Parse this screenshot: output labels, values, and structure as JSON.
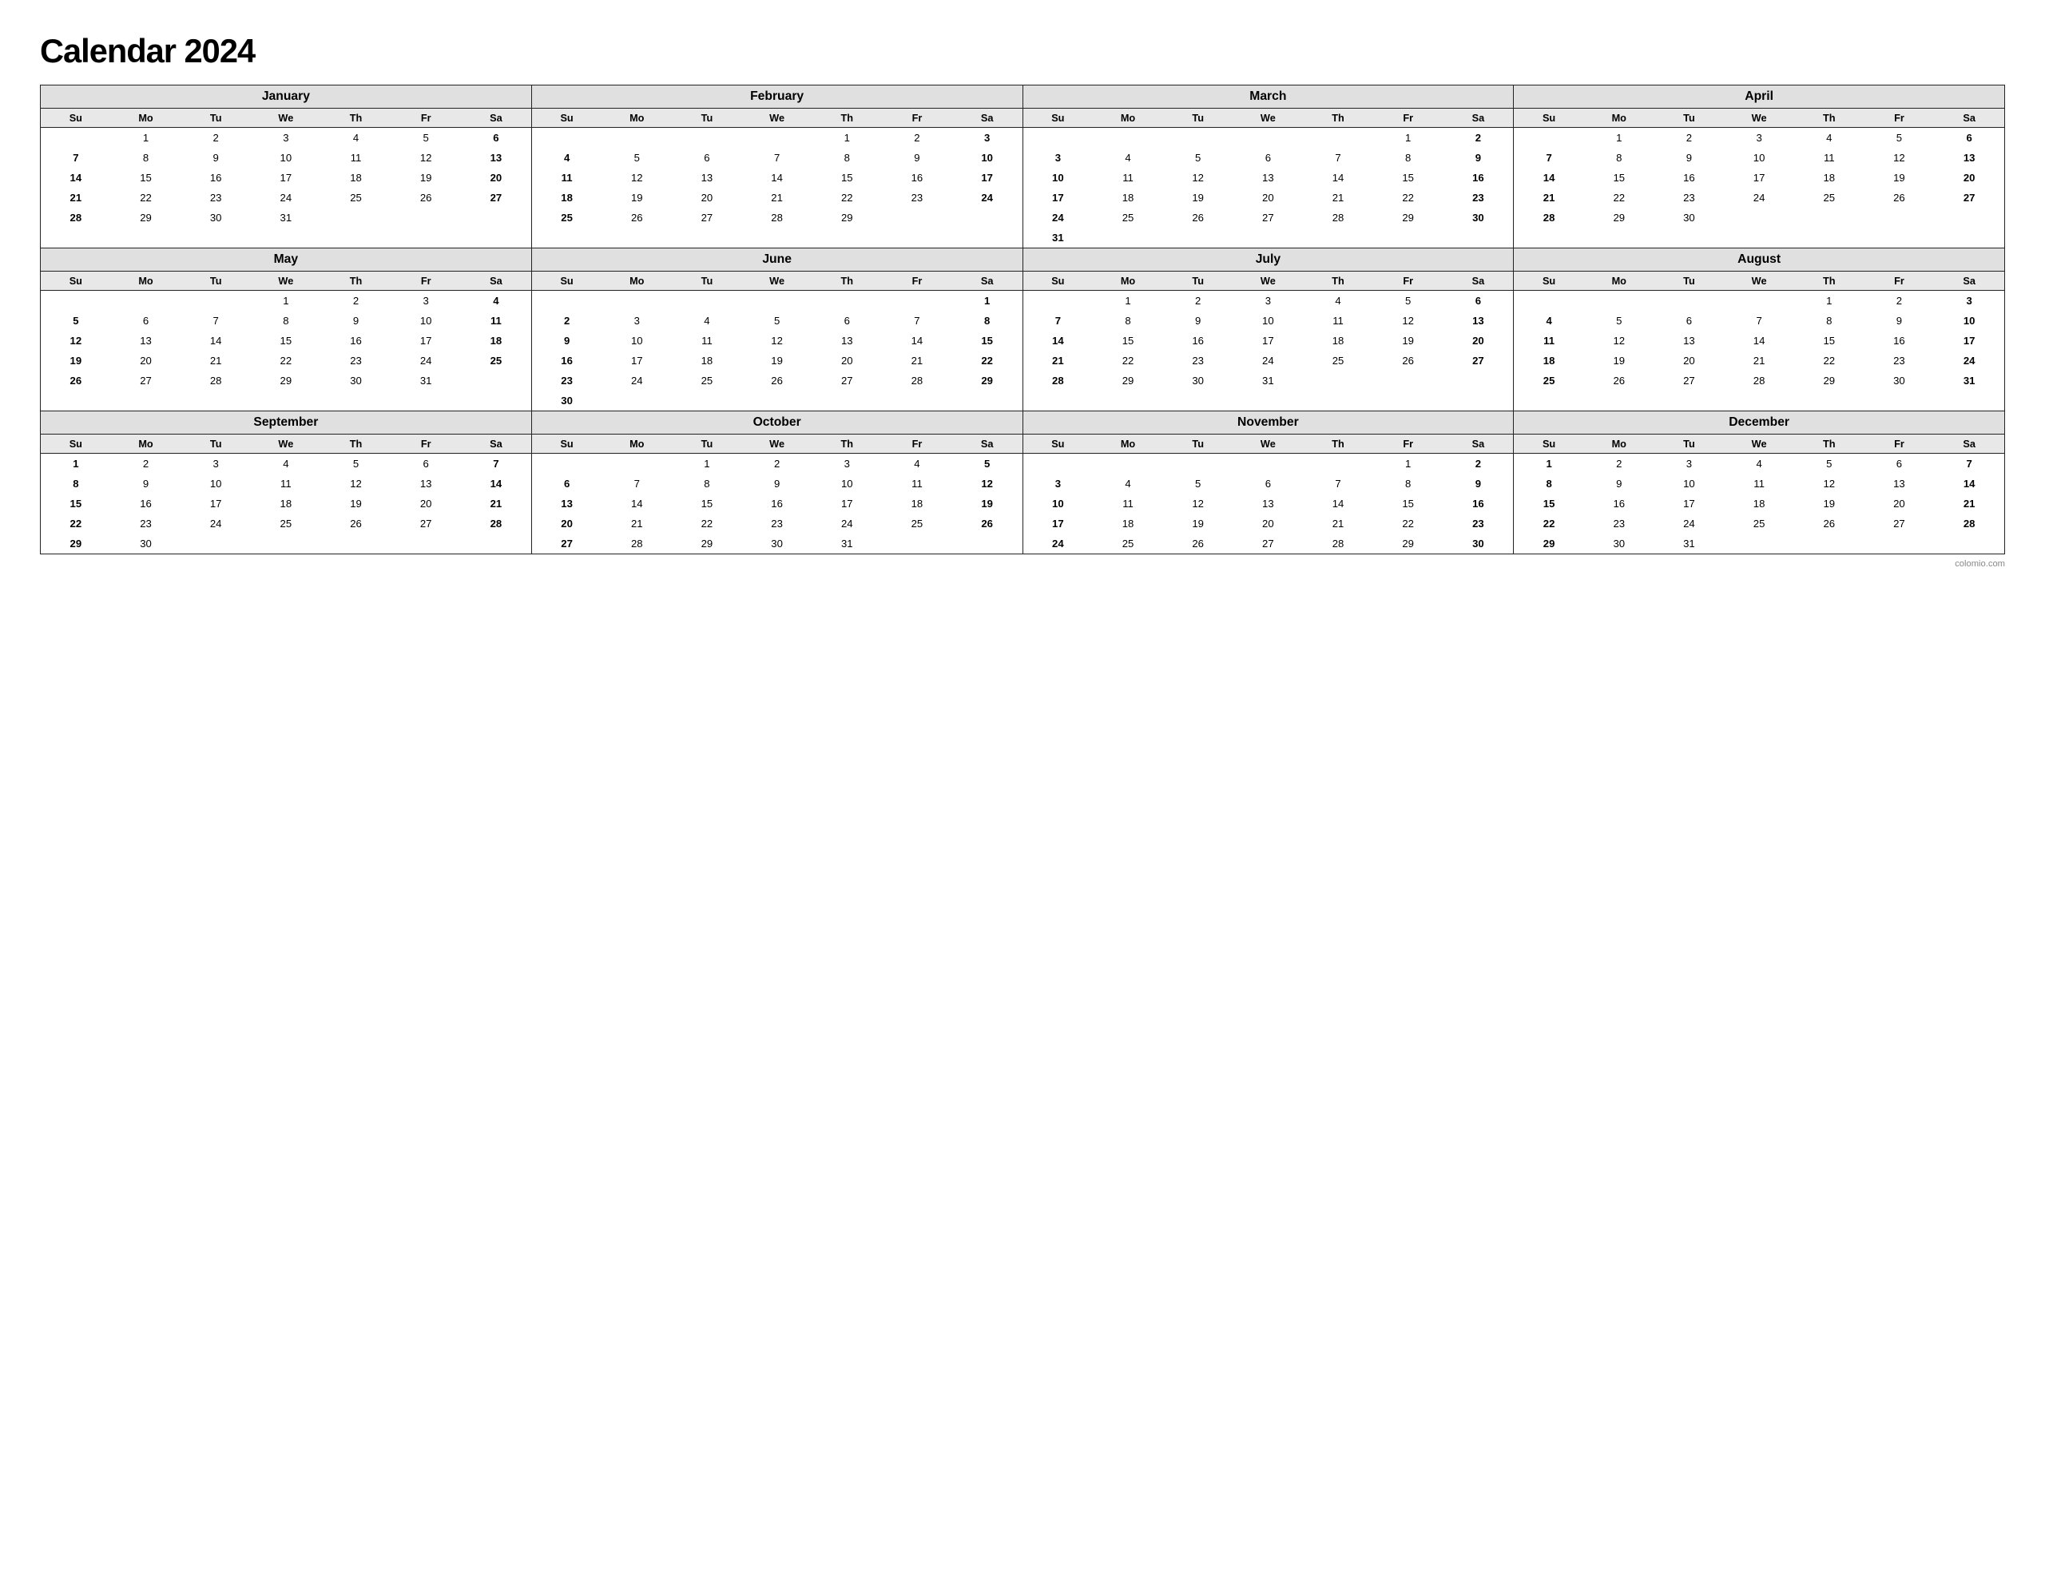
{
  "title": "Calendar 2024",
  "footer": "colomio.com",
  "months": [
    {
      "name": "January",
      "weeks": [
        [
          "",
          "1",
          "2",
          "3",
          "4",
          "5",
          "6"
        ],
        [
          "7",
          "8",
          "9",
          "10",
          "11",
          "12",
          "13"
        ],
        [
          "14",
          "15",
          "16",
          "17",
          "18",
          "19",
          "20"
        ],
        [
          "21",
          "22",
          "23",
          "24",
          "25",
          "26",
          "27"
        ],
        [
          "28",
          "29",
          "30",
          "31",
          "",
          "",
          ""
        ]
      ]
    },
    {
      "name": "February",
      "weeks": [
        [
          "",
          "",
          "",
          "",
          "1",
          "2",
          "3"
        ],
        [
          "4",
          "5",
          "6",
          "7",
          "8",
          "9",
          "10"
        ],
        [
          "11",
          "12",
          "13",
          "14",
          "15",
          "16",
          "17"
        ],
        [
          "18",
          "19",
          "20",
          "21",
          "22",
          "23",
          "24"
        ],
        [
          "25",
          "26",
          "27",
          "28",
          "29",
          "",
          ""
        ]
      ]
    },
    {
      "name": "March",
      "weeks": [
        [
          "",
          "",
          "",
          "",
          "",
          "1",
          "2"
        ],
        [
          "3",
          "4",
          "5",
          "6",
          "7",
          "8",
          "9"
        ],
        [
          "10",
          "11",
          "12",
          "13",
          "14",
          "15",
          "16"
        ],
        [
          "17",
          "18",
          "19",
          "20",
          "21",
          "22",
          "23"
        ],
        [
          "24",
          "25",
          "26",
          "27",
          "28",
          "29",
          "30"
        ],
        [
          "31",
          "",
          "",
          "",
          "",
          "",
          ""
        ]
      ]
    },
    {
      "name": "April",
      "weeks": [
        [
          "",
          "1",
          "2",
          "3",
          "4",
          "5",
          "6"
        ],
        [
          "7",
          "8",
          "9",
          "10",
          "11",
          "12",
          "13"
        ],
        [
          "14",
          "15",
          "16",
          "17",
          "18",
          "19",
          "20"
        ],
        [
          "21",
          "22",
          "23",
          "24",
          "25",
          "26",
          "27"
        ],
        [
          "28",
          "29",
          "30",
          "",
          "",
          "",
          ""
        ]
      ]
    },
    {
      "name": "May",
      "weeks": [
        [
          "",
          "",
          "",
          "1",
          "2",
          "3",
          "4"
        ],
        [
          "5",
          "6",
          "7",
          "8",
          "9",
          "10",
          "11"
        ],
        [
          "12",
          "13",
          "14",
          "15",
          "16",
          "17",
          "18"
        ],
        [
          "19",
          "20",
          "21",
          "22",
          "23",
          "24",
          "25"
        ],
        [
          "26",
          "27",
          "28",
          "29",
          "30",
          "31",
          ""
        ]
      ]
    },
    {
      "name": "June",
      "weeks": [
        [
          "",
          "",
          "",
          "",
          "",
          "",
          "1"
        ],
        [
          "2",
          "3",
          "4",
          "5",
          "6",
          "7",
          "8"
        ],
        [
          "9",
          "10",
          "11",
          "12",
          "13",
          "14",
          "15"
        ],
        [
          "16",
          "17",
          "18",
          "19",
          "20",
          "21",
          "22"
        ],
        [
          "23",
          "24",
          "25",
          "26",
          "27",
          "28",
          "29"
        ],
        [
          "30",
          "",
          "",
          "",
          "",
          "",
          ""
        ]
      ]
    },
    {
      "name": "July",
      "weeks": [
        [
          "",
          "1",
          "2",
          "3",
          "4",
          "5",
          "6"
        ],
        [
          "7",
          "8",
          "9",
          "10",
          "11",
          "12",
          "13"
        ],
        [
          "14",
          "15",
          "16",
          "17",
          "18",
          "19",
          "20"
        ],
        [
          "21",
          "22",
          "23",
          "24",
          "25",
          "26",
          "27"
        ],
        [
          "28",
          "29",
          "30",
          "31",
          "",
          "",
          ""
        ]
      ]
    },
    {
      "name": "August",
      "weeks": [
        [
          "",
          "",
          "",
          "",
          "1",
          "2",
          "3"
        ],
        [
          "4",
          "5",
          "6",
          "7",
          "8",
          "9",
          "10"
        ],
        [
          "11",
          "12",
          "13",
          "14",
          "15",
          "16",
          "17"
        ],
        [
          "18",
          "19",
          "20",
          "21",
          "22",
          "23",
          "24"
        ],
        [
          "25",
          "26",
          "27",
          "28",
          "29",
          "30",
          "31"
        ]
      ]
    },
    {
      "name": "September",
      "weeks": [
        [
          "1",
          "2",
          "3",
          "4",
          "5",
          "6",
          "7"
        ],
        [
          "8",
          "9",
          "10",
          "11",
          "12",
          "13",
          "14"
        ],
        [
          "15",
          "16",
          "17",
          "18",
          "19",
          "20",
          "21"
        ],
        [
          "22",
          "23",
          "24",
          "25",
          "26",
          "27",
          "28"
        ],
        [
          "29",
          "30",
          "",
          "",
          "",
          "",
          ""
        ]
      ]
    },
    {
      "name": "October",
      "weeks": [
        [
          "",
          "",
          "1",
          "2",
          "3",
          "4",
          "5"
        ],
        [
          "6",
          "7",
          "8",
          "9",
          "10",
          "11",
          "12"
        ],
        [
          "13",
          "14",
          "15",
          "16",
          "17",
          "18",
          "19"
        ],
        [
          "20",
          "21",
          "22",
          "23",
          "24",
          "25",
          "26"
        ],
        [
          "27",
          "28",
          "29",
          "30",
          "31",
          "",
          ""
        ]
      ]
    },
    {
      "name": "November",
      "weeks": [
        [
          "",
          "",
          "",
          "",
          "",
          "1",
          "2"
        ],
        [
          "3",
          "4",
          "5",
          "6",
          "7",
          "8",
          "9"
        ],
        [
          "10",
          "11",
          "12",
          "13",
          "14",
          "15",
          "16"
        ],
        [
          "17",
          "18",
          "19",
          "20",
          "21",
          "22",
          "23"
        ],
        [
          "24",
          "25",
          "26",
          "27",
          "28",
          "29",
          "30"
        ]
      ]
    },
    {
      "name": "December",
      "weeks": [
        [
          "1",
          "2",
          "3",
          "4",
          "5",
          "6",
          "7"
        ],
        [
          "8",
          "9",
          "10",
          "11",
          "12",
          "13",
          "14"
        ],
        [
          "15",
          "16",
          "17",
          "18",
          "19",
          "20",
          "21"
        ],
        [
          "22",
          "23",
          "24",
          "25",
          "26",
          "27",
          "28"
        ],
        [
          "29",
          "30",
          "31",
          "",
          "",
          "",
          ""
        ]
      ]
    }
  ],
  "dayHeaders": [
    "Su",
    "Mo",
    "Tu",
    "We",
    "Th",
    "Fr",
    "Sa"
  ]
}
